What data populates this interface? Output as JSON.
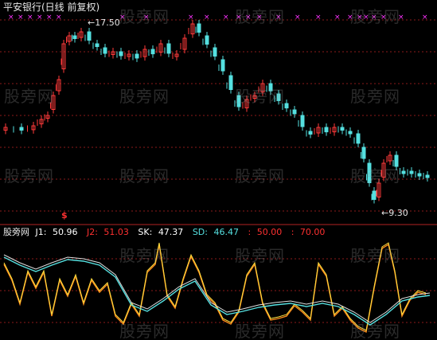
{
  "window": {
    "title": "平安银行(日线 前复权)"
  },
  "watermark": "股旁网",
  "price_panel": {
    "high_label": "17.50",
    "low_label": "9.30",
    "buy_marker": "$",
    "signal_marker": "×",
    "signals_count_hint": "magenta crosses along top",
    "colors": {
      "up": "#ff3a3a",
      "down": "#55e0e0",
      "grid": "#8b1a1a",
      "signal": "#ff33ff"
    }
  },
  "indicator_panel": {
    "name": "股旁网",
    "items": [
      {
        "label": "J1:",
        "value": "50.96",
        "color": "#ffffff"
      },
      {
        "label": "J2:",
        "value": "51.03",
        "color": "#ff3030"
      },
      {
        "label": "SK:",
        "value": "47.37",
        "color": "#ffffff"
      },
      {
        "label": "SD:",
        "value": "46.47",
        "color": "#55e0e0"
      },
      {
        "label": ":",
        "value": "50.00",
        "color": "#ff3030"
      },
      {
        "label": ":",
        "value": "70.00",
        "color": "#ff3030"
      }
    ]
  }
}
